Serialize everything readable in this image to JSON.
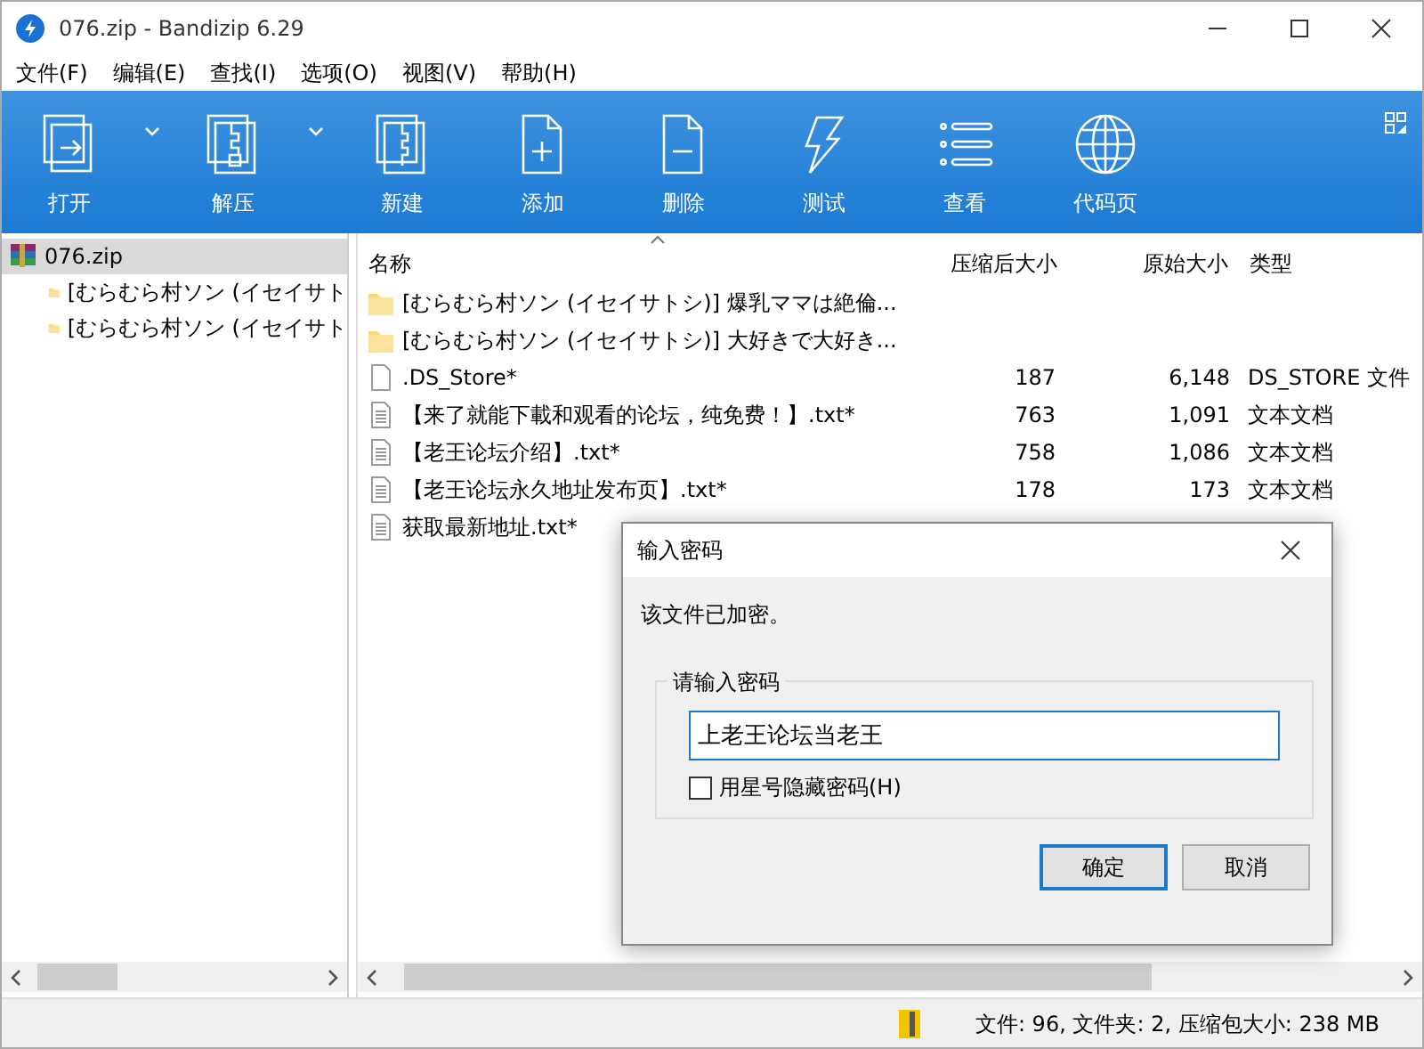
{
  "window": {
    "title": "076.zip - Bandizip 6.29"
  },
  "menu": [
    "文件(F)",
    "编辑(E)",
    "查找(I)",
    "选项(O)",
    "视图(V)",
    "帮助(H)"
  ],
  "toolbar": [
    {
      "kind": "open",
      "label": "打开",
      "dropdown": true
    },
    {
      "kind": "extract",
      "label": "解压",
      "dropdown": true
    },
    {
      "kind": "new",
      "label": "新建",
      "dropdown": false
    },
    {
      "kind": "add",
      "label": "添加",
      "dropdown": false
    },
    {
      "kind": "delete",
      "label": "删除",
      "dropdown": false
    },
    {
      "kind": "test",
      "label": "测试",
      "dropdown": false
    },
    {
      "kind": "view",
      "label": "查看",
      "dropdown": false
    },
    {
      "kind": "codepage",
      "label": "代码页",
      "dropdown": false
    }
  ],
  "tree": {
    "label": "076.zip",
    "selected": true,
    "children": [
      {
        "label": "[むらむら村ソン (イセイサト",
        "selected": false
      },
      {
        "label": "[むらむら村ソン (イセイサト",
        "selected": false
      }
    ]
  },
  "file_list": {
    "columns": [
      {
        "label": "名称",
        "sorted": true
      },
      {
        "label": "压缩后大小",
        "sorted": false
      },
      {
        "label": "原始大小",
        "sorted": false
      },
      {
        "label": "类型",
        "sorted": false
      }
    ],
    "rows": [
      {
        "kind": "folder",
        "name": "[むらむら村ソン (イセイサトシ)] 爆乳ママは絶倫..."
      },
      {
        "kind": "folder",
        "name": "[むらむら村ソン (イセイサトシ)] 大好きで大好き..."
      },
      {
        "kind": "file",
        "name": ".DS_Store*",
        "packed": "187",
        "original": "6,148",
        "type": "DS_STORE 文件"
      },
      {
        "kind": "text",
        "name": "【来了就能下載和观看的论坛，纯免费！】.txt*",
        "packed": "763",
        "original": "1,091",
        "type": "文本文档"
      },
      {
        "kind": "text",
        "name": "【老王论坛介绍】.txt*",
        "packed": "758",
        "original": "1,086",
        "type": "文本文档"
      },
      {
        "kind": "text",
        "name": "【老王论坛永久地址发布页】.txt*",
        "packed": "178",
        "original": "173",
        "type": "文本文档"
      },
      {
        "kind": "text",
        "name": "获取最新地址.txt*"
      }
    ]
  },
  "dialog": {
    "title": "输入密码",
    "message": "该文件已加密。",
    "group_label": "请输入密码",
    "password": "上老王论坛当老王",
    "checkbox": {
      "label": "用星号隐藏密码(H)",
      "checked": false
    },
    "buttons": [
      {
        "label": "确定",
        "default": true
      },
      {
        "label": "取消",
        "default": false
      }
    ]
  },
  "status_bar": {
    "text": "文件: 96, 文件夹: 2, 压缩包大小: 238 MB"
  }
}
